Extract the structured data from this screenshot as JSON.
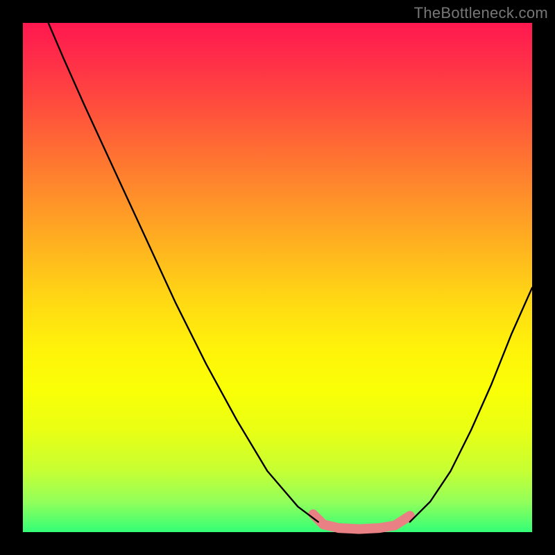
{
  "watermark": "TheBottleneck.com",
  "chart_data": {
    "type": "line",
    "title": "",
    "xlabel": "",
    "ylabel": "",
    "xlim": [
      0,
      100
    ],
    "ylim": [
      0,
      100
    ],
    "series": [
      {
        "name": "black-left",
        "stroke": "#000000",
        "width": 2.4,
        "points": [
          {
            "x": 5,
            "y": 100
          },
          {
            "x": 8,
            "y": 93
          },
          {
            "x": 12,
            "y": 84
          },
          {
            "x": 18,
            "y": 71
          },
          {
            "x": 24,
            "y": 58
          },
          {
            "x": 30,
            "y": 45
          },
          {
            "x": 36,
            "y": 33
          },
          {
            "x": 42,
            "y": 22
          },
          {
            "x": 48,
            "y": 12
          },
          {
            "x": 54,
            "y": 5
          },
          {
            "x": 58,
            "y": 2
          }
        ]
      },
      {
        "name": "black-right",
        "stroke": "#000000",
        "width": 2.4,
        "points": [
          {
            "x": 76,
            "y": 2
          },
          {
            "x": 80,
            "y": 6
          },
          {
            "x": 84,
            "y": 12
          },
          {
            "x": 88,
            "y": 20
          },
          {
            "x": 92,
            "y": 29
          },
          {
            "x": 96,
            "y": 39
          },
          {
            "x": 100,
            "y": 48
          }
        ]
      },
      {
        "name": "pink-bottom",
        "stroke": "#e88084",
        "width": 14,
        "points": [
          {
            "x": 57,
            "y": 3.5
          },
          {
            "x": 59,
            "y": 1.5
          },
          {
            "x": 62,
            "y": 0.8
          },
          {
            "x": 66,
            "y": 0.6
          },
          {
            "x": 70,
            "y": 0.8
          },
          {
            "x": 73,
            "y": 1.3
          },
          {
            "x": 76,
            "y": 3.2
          }
        ]
      }
    ]
  }
}
